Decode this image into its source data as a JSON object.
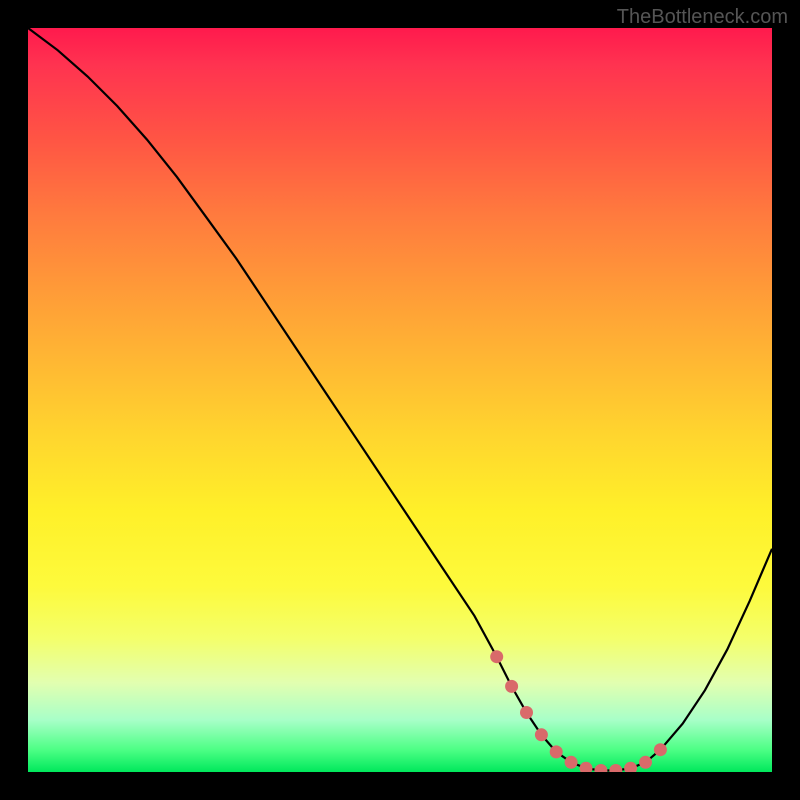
{
  "watermark": "TheBottleneck.com",
  "chart_data": {
    "type": "line",
    "title": "",
    "xlabel": "",
    "ylabel": "",
    "xlim": [
      0,
      100
    ],
    "ylim": [
      0,
      100
    ],
    "series": [
      {
        "name": "curve",
        "x": [
          0,
          4,
          8,
          12,
          16,
          20,
          24,
          28,
          32,
          36,
          40,
          44,
          48,
          52,
          56,
          60,
          63,
          65,
          67,
          69,
          71,
          73,
          75,
          77,
          79,
          81,
          83,
          85,
          88,
          91,
          94,
          97,
          100
        ],
        "values": [
          100,
          97,
          93.5,
          89.5,
          85,
          80,
          74.5,
          69,
          63,
          57,
          51,
          45,
          39,
          33,
          27,
          21,
          15.5,
          11.5,
          8,
          5,
          2.7,
          1.3,
          0.5,
          0.2,
          0.2,
          0.5,
          1.3,
          3,
          6.5,
          11,
          16.5,
          23,
          30
        ]
      },
      {
        "name": "markers",
        "x": [
          63,
          65,
          67,
          69,
          71,
          73,
          75,
          77,
          79,
          81,
          83,
          85
        ],
        "values": [
          15.5,
          11.5,
          8,
          5,
          2.7,
          1.3,
          0.5,
          0.2,
          0.2,
          0.5,
          1.3,
          3
        ]
      }
    ],
    "colors": {
      "curve": "#000000",
      "markers": "#d96a6a",
      "gradient_top": "#ff1a4d",
      "gradient_bottom": "#00e85c"
    }
  }
}
